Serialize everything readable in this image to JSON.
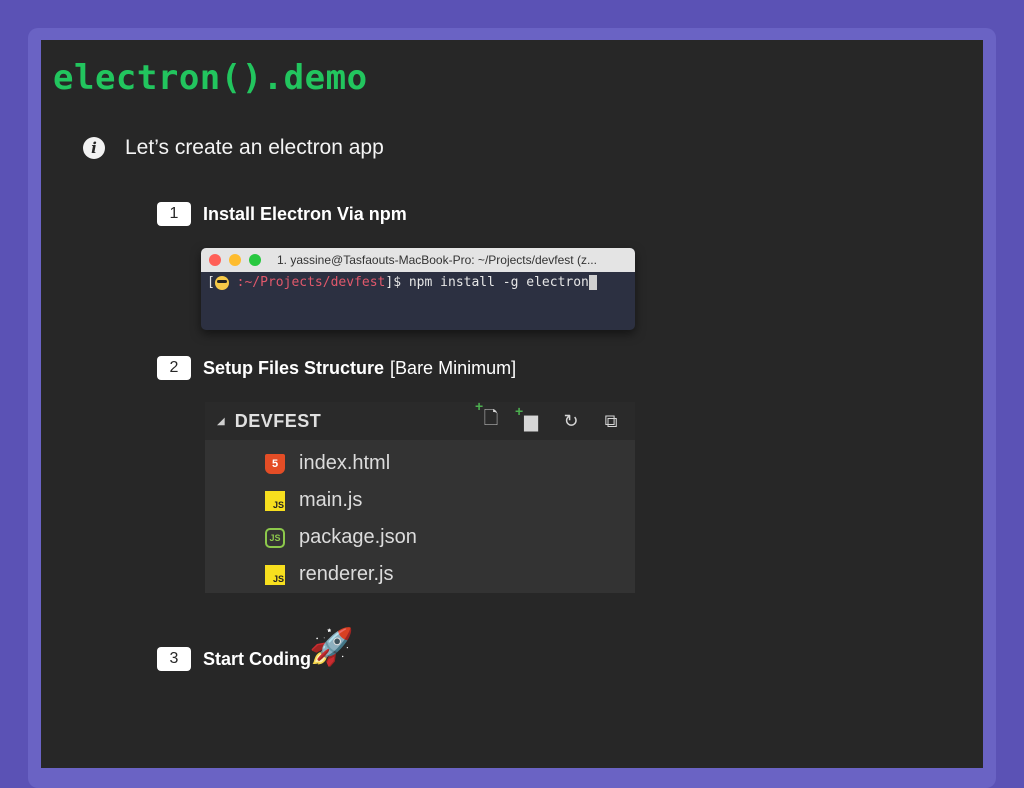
{
  "slide": {
    "title": "electron().demo",
    "intro": "Let’s create an electron app"
  },
  "steps": [
    {
      "number": "1",
      "label": "Install Electron Via npm",
      "note": ""
    },
    {
      "number": "2",
      "label": "Setup Files Structure",
      "note": "[Bare Minimum]"
    },
    {
      "number": "3",
      "label": "Start Coding",
      "note": ""
    }
  ],
  "terminal": {
    "title": "1. yassine@Tasfaouts-MacBook-Pro: ~/Projects/devfest (z...",
    "prompt_open": "[",
    "path": ":~/Projects/devfest",
    "prompt_close": "]$",
    "command": "npm install -g electron",
    "traffic_lights": [
      "#ff5f57",
      "#febc2e",
      "#28c840"
    ]
  },
  "explorer": {
    "folder": "DEVFEST",
    "actions": [
      "new-file-icon",
      "new-folder-icon",
      "refresh-icon",
      "collapse-all-icon"
    ],
    "files": [
      {
        "name": "index.html",
        "icon": "html5-icon"
      },
      {
        "name": "main.js",
        "icon": "js-icon"
      },
      {
        "name": "package.json",
        "icon": "nodejs-icon"
      },
      {
        "name": "renderer.js",
        "icon": "js-icon"
      }
    ]
  },
  "colors": {
    "background": "#5b52b5",
    "slide": "#272727",
    "title": "#22c55e",
    "path": "#e0586b"
  }
}
